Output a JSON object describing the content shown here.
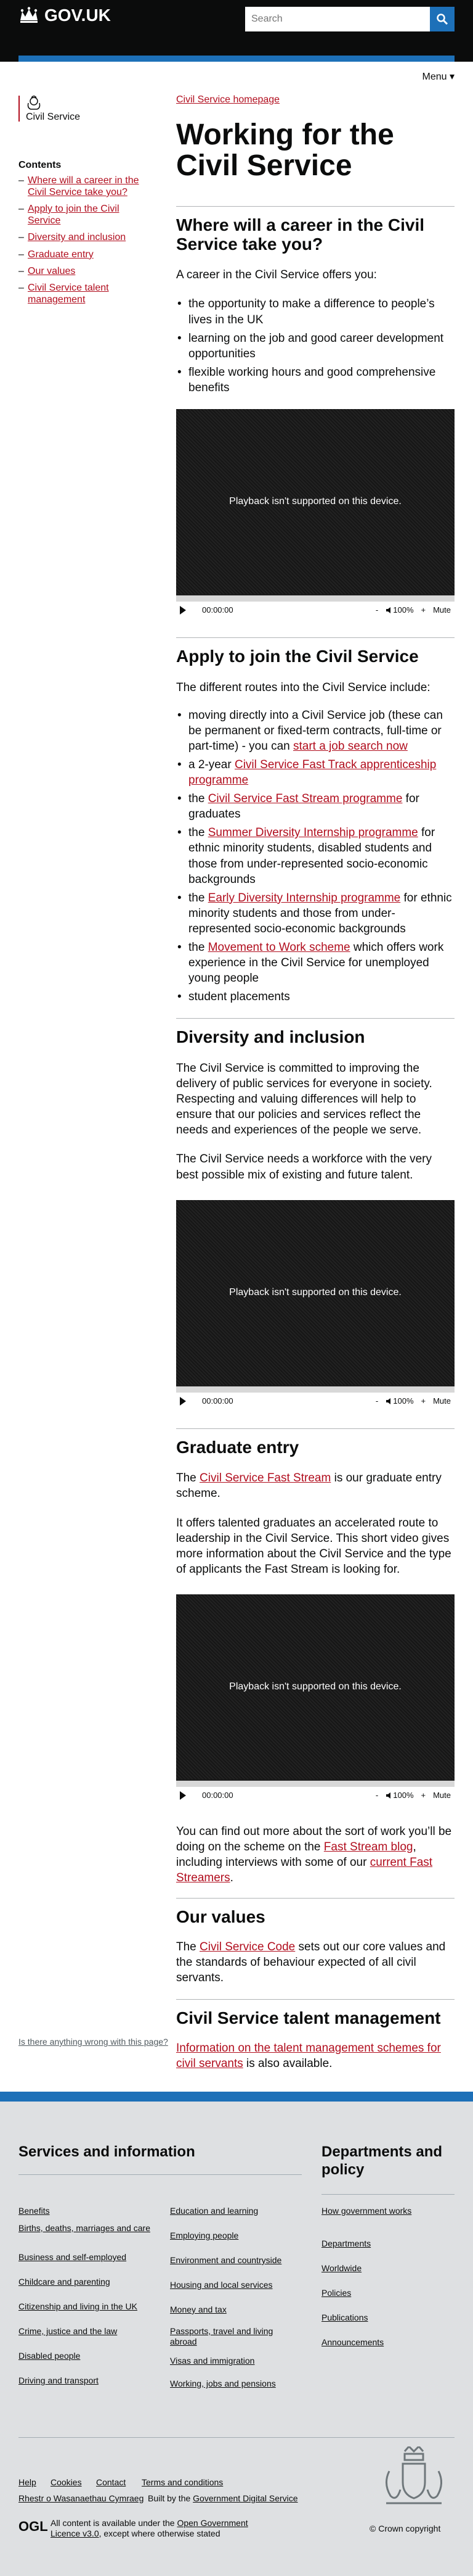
{
  "header": {
    "logo_text": "GOV.UK",
    "search_placeholder": "Search",
    "menu_label": "Menu ▾",
    "colors": {
      "bg": "#0b0c0c",
      "accent": "#1d70b8"
    }
  },
  "org": {
    "name": "Civil Service",
    "brand_color": "#b10e1e"
  },
  "breadcrumb": "Civil Service homepage",
  "contents": {
    "title": "Contents",
    "items": [
      "Where will a career in the Civil Service take you?",
      "Apply to join the Civil Service",
      "Diversity and inclusion",
      "Graduate entry",
      "Our values",
      "Civil Service talent management"
    ]
  },
  "title": "Working for the Civil Service",
  "career": {
    "heading": "Where will a career in the Civil Service take you?",
    "intro": "A career in the Civil Service offers you:",
    "bullets": [
      "the opportunity to make a difference to people’s lives in the UK",
      "learning on the job and good career development opportunities",
      "flexible working hours and good comprehensive benefits"
    ]
  },
  "video": {
    "message": "Playback isn't supported on this device.",
    "time": "00:00:00",
    "minus": "-",
    "volume": "100%",
    "plus": "+",
    "mute": "Mute"
  },
  "apply": {
    "heading": "Apply to join the Civil Service",
    "intro": "The different routes into the Civil Service include:",
    "b1_text": "moving directly into a Civil Service job (these can be permanent or fixed-term contracts, full-time or part-time) - you can ",
    "b1_link": "start a job search now",
    "b2_pre": "a 2-year ",
    "b2_link": "Civil Service Fast Track apprenticeship programme",
    "b3_pre": "the ",
    "b3_link": "Civil Service Fast Stream programme",
    "b3_post": " for graduates",
    "b4_pre": "the ",
    "b4_link": "Summer Diversity Internship programme",
    "b4_post": " for ethnic minority students, disabled students and those from under-represented socio-economic backgrounds",
    "b5_pre": "the ",
    "b5_link": "Early Diversity Internship programme",
    "b5_post": " for ethnic minority students and those from under-represented socio-economic backgrounds",
    "b6_pre": "the ",
    "b6_link": "Movement to Work scheme",
    "b6_post": " which offers work experience in the Civil Service for unemployed young people",
    "b7": "student placements"
  },
  "diversity": {
    "heading": "Diversity and inclusion",
    "p1": "The Civil Service is committed to improving the delivery of public services for everyone in society. Respecting and valuing differences will help to ensure that our policies and services reflect the needs and experiences of the people we serve.",
    "p2": "The Civil Service needs a workforce with the very best possible mix of existing and future talent."
  },
  "graduate": {
    "heading": "Graduate entry",
    "p1_pre": "The ",
    "p1_link": "Civil Service Fast Stream",
    "p1_post": " is our graduate entry scheme.",
    "p2": "It offers talented graduates an accelerated route to leadership in the Civil Service. This short video gives more information about the Civil Service and the type of applicants the Fast Stream is looking for.",
    "p3_pre": "You can find out more about the sort of work you’ll be doing on the scheme on the ",
    "p3_link1": "Fast Stream blog",
    "p3_mid": ", including interviews with some of our ",
    "p3_link2": "current Fast Streamers",
    "p3_post": "."
  },
  "values": {
    "heading": "Our values",
    "p_pre": "The ",
    "p_link": "Civil Service Code",
    "p_post": " sets out our core values and the standards of behaviour expected of all civil servants."
  },
  "talent": {
    "heading": "Civil Service talent management",
    "p_link": "Information on the talent management schemes for civil servants",
    "p_post": " is also available."
  },
  "report_link": "Is there anything wrong with this page?",
  "footer": {
    "services_heading": "Services and information",
    "col1": [
      "Benefits",
      "Births, deaths, marriages and care",
      "Business and self-employed",
      "Childcare and parenting",
      "Citizenship and living in the UK",
      "Crime, justice and the law",
      "Disabled people",
      "Driving and transport"
    ],
    "col2": [
      "Education and learning",
      "Employing people",
      "Environment and countryside",
      "Housing and local services",
      "Money and tax",
      "Passports, travel and living abroad",
      "Visas and immigration",
      "Working, jobs and pensions"
    ],
    "departments_heading": "Departments and policy",
    "col3": [
      "How government works",
      "Departments",
      "Worldwide",
      "Policies",
      "Publications",
      "Announcements"
    ],
    "meta_links": [
      "Help",
      "Cookies",
      "Contact",
      "Terms and conditions"
    ],
    "welsh": "Rhestr o Wasanaethau Cymraeg",
    "built_pre": "Built by the ",
    "built_link": "Government Digital Service",
    "ogl": "OGL",
    "licence_pre": "All content is available under the ",
    "licence_link": "Open Government Licence v3.0",
    "licence_post": ", except where otherwise stated",
    "copyright": "© Crown copyright"
  }
}
